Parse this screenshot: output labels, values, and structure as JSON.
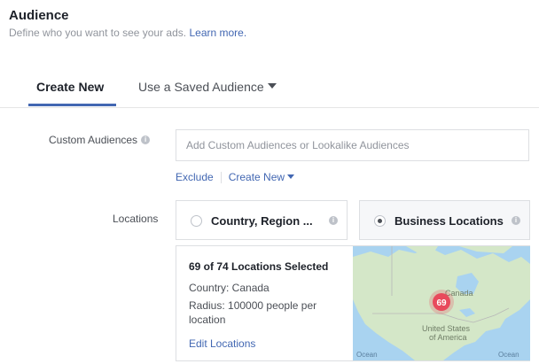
{
  "header": {
    "title": "Audience",
    "subtitle": "Define who you want to see your ads.",
    "learn_more": "Learn more."
  },
  "tabs": [
    {
      "label": "Create New",
      "active": true
    },
    {
      "label": "Use a Saved Audience",
      "active": false
    }
  ],
  "custom_audiences": {
    "label": "Custom Audiences",
    "placeholder": "Add Custom Audiences or Lookalike Audiences",
    "exclude_label": "Exclude",
    "create_new_label": "Create New"
  },
  "locations": {
    "label": "Locations",
    "options": [
      {
        "label": "Country, Region ...",
        "selected": false
      },
      {
        "label": "Business Locations",
        "selected": true
      }
    ],
    "detail": {
      "heading": "69 of 74 Locations Selected",
      "country": "Country: Canada",
      "radius": "Radius: 100000 people per location",
      "edit": "Edit Locations"
    },
    "map": {
      "cluster_count": "69",
      "label_country": "United States of America",
      "label_ocean": "Ocean",
      "label_canada": "Canada"
    }
  },
  "colors": {
    "accent": "#4267b2",
    "map_land": "#d4e7c8",
    "map_water": "#a9d3f0",
    "cluster": "#e8495c"
  },
  "icons": [
    "info-icon",
    "caret-down-icon",
    "radio-icon"
  ]
}
